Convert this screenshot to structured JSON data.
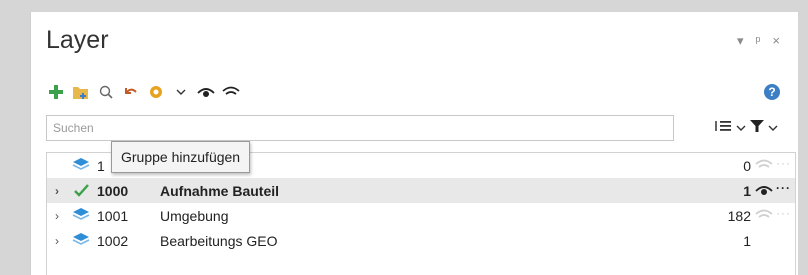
{
  "panel": {
    "title": "Layer",
    "controls": {
      "dropdown_icon": "chevron-down-icon",
      "pin_icon": "pin-icon",
      "close_icon": "close-icon"
    }
  },
  "toolbar": {
    "items": [
      "add-icon",
      "add-group-icon",
      "search-icon",
      "undo-icon",
      "settings-gear-icon",
      "chevron-down-icon",
      "eye-open-icon",
      "eye-closed-icon"
    ],
    "help_label": "?"
  },
  "search": {
    "placeholder": "Suchen"
  },
  "tooltip": {
    "text": "Gruppe hinzufügen"
  },
  "layers": [
    {
      "expander": "",
      "number": "1",
      "name": "",
      "count": "0",
      "visible": false,
      "selected": false,
      "icon": "layer-stack-icon"
    },
    {
      "expander": "›",
      "number": "1000",
      "name": "Aufnahme Bauteil",
      "count": "1",
      "visible": true,
      "selected": true,
      "icon": "checkmark-icon"
    },
    {
      "expander": "›",
      "number": "1001",
      "name": "Umgebung",
      "count": "182",
      "visible": false,
      "selected": false,
      "icon": "layer-stack-icon"
    },
    {
      "expander": "›",
      "number": "1002",
      "name": "Bearbeitungs GEO",
      "count": "1",
      "visible": null,
      "selected": false,
      "icon": "layer-stack-icon"
    }
  ],
  "colors": {
    "accent_blue": "#3d7fc4",
    "add_green": "#3aa14a",
    "folder_yellow": "#e8b84a",
    "gear_orange": "#e8a21f",
    "selected_row": "#e8e8e8"
  }
}
